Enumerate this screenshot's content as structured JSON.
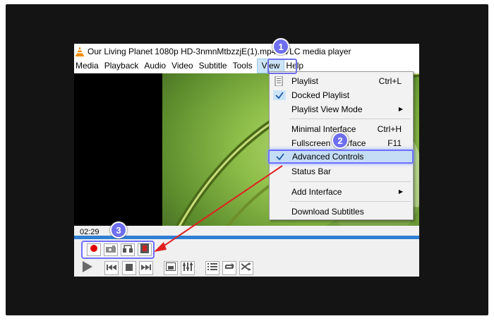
{
  "window": {
    "title": "Our Living Planet 1080p HD-3nmnMtbzzjE(1).mp4 - VLC media player"
  },
  "menubar": {
    "items": [
      "Media",
      "Playback",
      "Audio",
      "Video",
      "Subtitle",
      "Tools",
      "View",
      "Help"
    ]
  },
  "view_menu": {
    "items": [
      {
        "label": "Playlist",
        "shortcut": "Ctrl+L",
        "icon": "playlist-icon"
      },
      {
        "label": "Docked Playlist",
        "shortcut": "",
        "checked": true
      },
      {
        "label": "Playlist View Mode",
        "shortcut": "",
        "submenu": true
      },
      {
        "label": "Minimal Interface",
        "shortcut": "Ctrl+H"
      },
      {
        "label": "Fullscreen Interface",
        "shortcut": "F11"
      },
      {
        "label": "Advanced Controls",
        "shortcut": "",
        "checked": true,
        "highlighted": true
      },
      {
        "label": "Status Bar",
        "shortcut": ""
      },
      {
        "label": "Add Interface",
        "shortcut": "",
        "submenu": true
      },
      {
        "label": "Download Subtitles",
        "shortcut": ""
      }
    ]
  },
  "player": {
    "elapsed_time": "02:29"
  },
  "annotations": {
    "step1": "1",
    "step2": "2",
    "step3": "3"
  },
  "colors": {
    "annotation": "#6e6ef0",
    "arrow": "#e02020",
    "seek": "#2f7fd4",
    "highlight": "#c4ddf5"
  },
  "icons": [
    "vlc-cone-icon",
    "record-icon",
    "snapshot-icon",
    "loop-ab-icon",
    "frame-by-frame-icon",
    "play-icon",
    "previous-icon",
    "stop-icon",
    "next-icon",
    "fullscreen-icon",
    "extended-settings-icon",
    "playlist-icon",
    "loop-icon",
    "shuffle-icon"
  ]
}
